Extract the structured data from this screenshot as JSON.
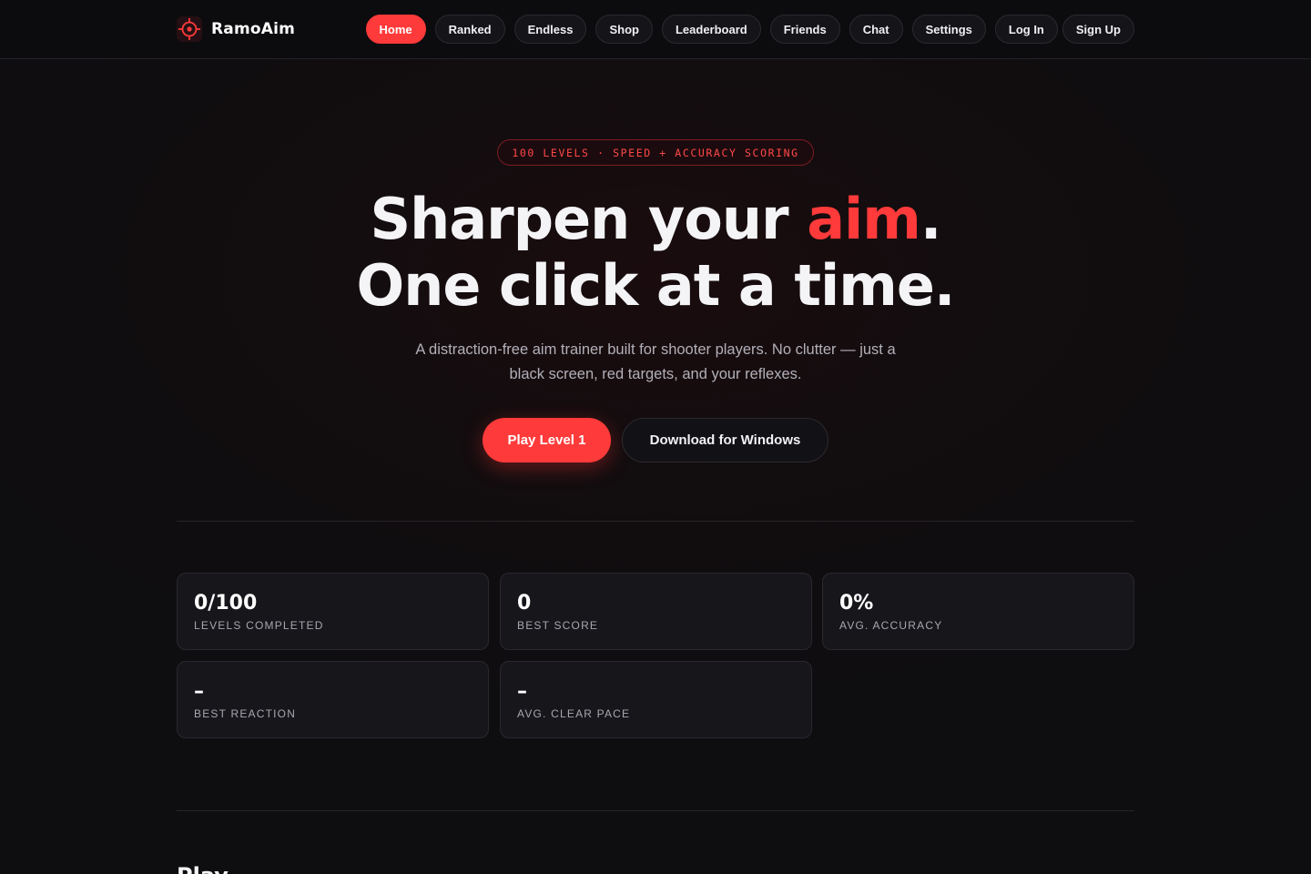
{
  "brand": {
    "name": "RamoAim",
    "icon": "crosshair-icon",
    "accent": "#ff3a3a"
  },
  "nav": {
    "items": [
      "Home",
      "Ranked",
      "Endless",
      "Shop",
      "Leaderboard",
      "Friends",
      "Chat",
      "Settings"
    ],
    "active": "Home",
    "login": "Log In",
    "signup": "Sign Up"
  },
  "hero": {
    "badge": "100 LEVELS · SPEED + ACCURACY SCORING",
    "headline_part1": "Sharpen your ",
    "headline_accent": "aim",
    "headline_part2": ".",
    "headline_line2": "One click at a time.",
    "subtitle": "A distraction-free aim trainer built for shooter players. No clutter — just a black screen, red targets, and your reflexes.",
    "primary_cta": "Play Level 1",
    "secondary_cta": "Download for Windows"
  },
  "stats": [
    {
      "value": "0/100",
      "label": "LEVELS COMPLETED"
    },
    {
      "value": "0",
      "label": "BEST SCORE"
    },
    {
      "value": "0%",
      "label": "AVG. ACCURACY"
    },
    {
      "value": "–",
      "label": "BEST REACTION"
    },
    {
      "value": "–",
      "label": "AVG. CLEAR PACE"
    }
  ],
  "next_section": {
    "title": "Play"
  }
}
